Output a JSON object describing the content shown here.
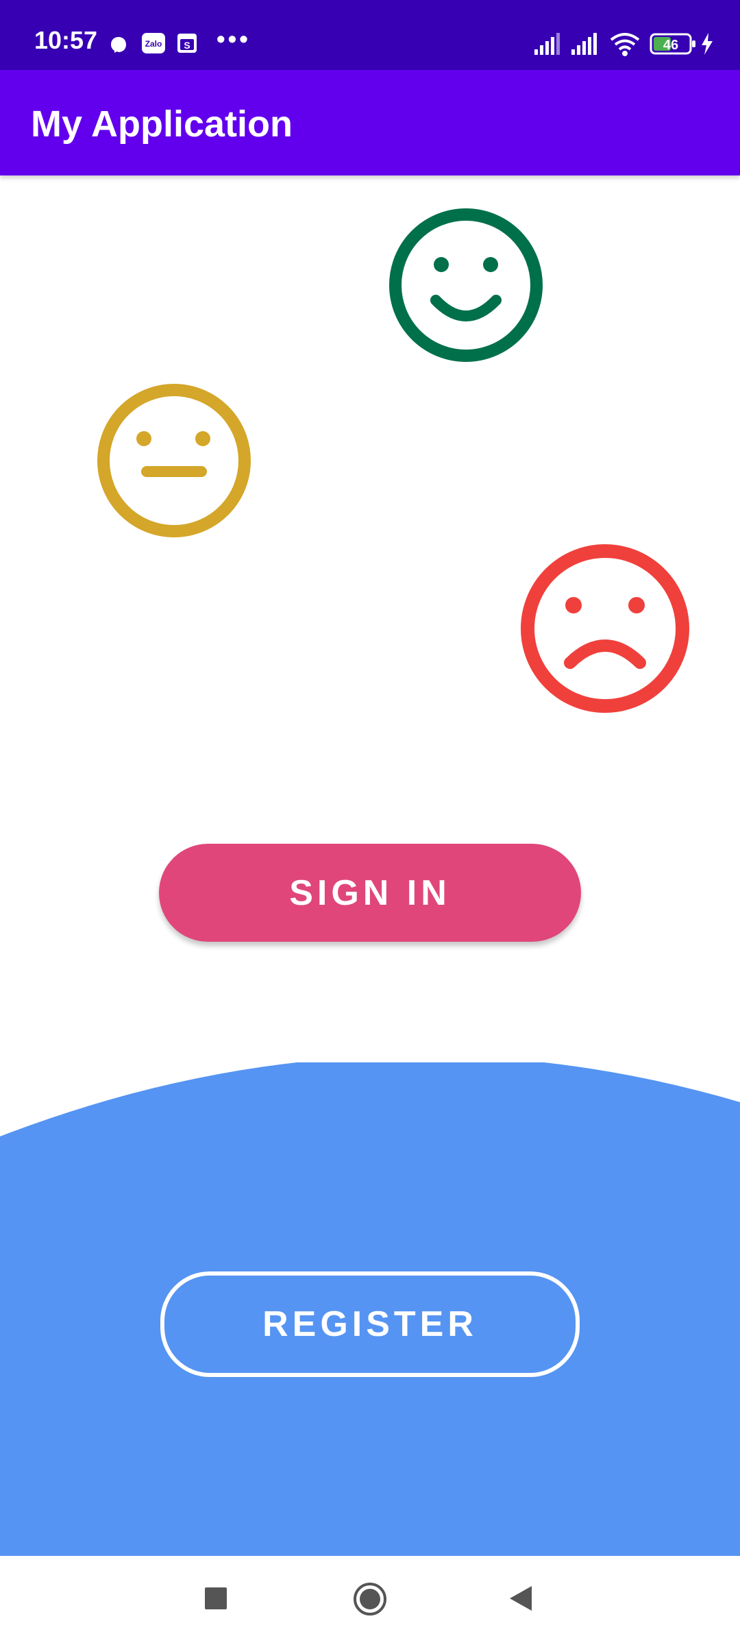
{
  "status_bar": {
    "time": "10:57",
    "dots": "•••",
    "battery": "46",
    "background": "#3700b3",
    "icons": [
      "messenger-icon",
      "zalo-icon",
      "s-app-icon",
      "signal-icon",
      "signal-icon",
      "wifi-icon",
      "battery-icon",
      "charging-icon"
    ]
  },
  "app_bar": {
    "title": "My Application",
    "background": "#6200ee"
  },
  "emojis": {
    "happy": {
      "color": "#00704a",
      "icon": "happy-face-icon"
    },
    "neutral": {
      "color": "#d4a629",
      "icon": "neutral-face-icon"
    },
    "sad": {
      "color": "#f0403c",
      "icon": "sad-face-icon"
    }
  },
  "buttons": {
    "sign_in": "SIGN IN",
    "sign_in_color": "#e04679",
    "register": "REGISTER"
  },
  "arc_color": "#5594f2",
  "nav_bar": {
    "icons": [
      "recents-square-icon",
      "home-circle-icon",
      "back-triangle-icon"
    ]
  }
}
